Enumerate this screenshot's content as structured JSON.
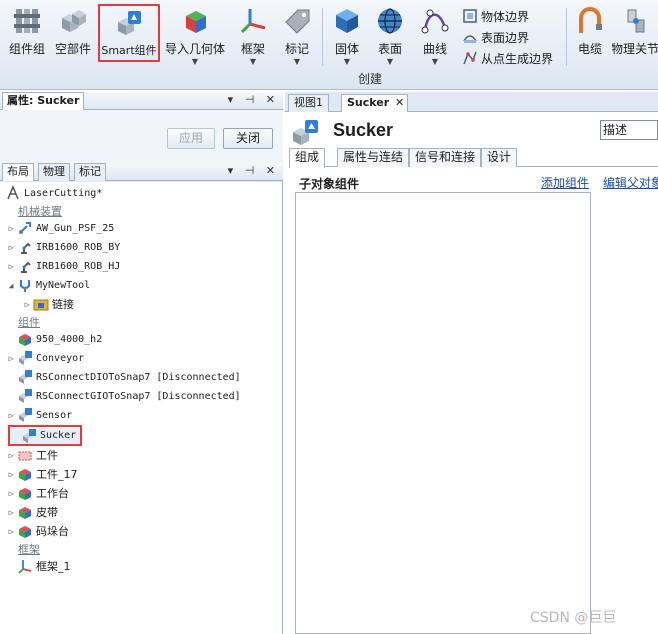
{
  "ribbon": {
    "buttons": [
      {
        "label": "组件组",
        "icon": "component-group-icon"
      },
      {
        "label": "空部件",
        "icon": "empty-part-icon"
      },
      {
        "label": "Smart组件",
        "icon": "smart-component-icon"
      },
      {
        "label": "导入几何体",
        "icon": "import-geometry-icon"
      },
      {
        "label": "框架",
        "icon": "frame-icon"
      },
      {
        "label": "标记",
        "icon": "tag-icon"
      },
      {
        "label": "固体",
        "icon": "solid-icon"
      },
      {
        "label": "表面",
        "icon": "surface-icon"
      },
      {
        "label": "曲线",
        "icon": "curve-icon"
      },
      {
        "label": "电缆",
        "icon": "cable-icon"
      },
      {
        "label": "物理关节",
        "icon": "physics-joint-icon"
      }
    ],
    "small_buttons": [
      {
        "label": "物体边界",
        "icon": "body-border-icon"
      },
      {
        "label": "表面边界",
        "icon": "surface-border-icon"
      },
      {
        "label": "从点生成边界",
        "icon": "border-from-points-icon"
      }
    ],
    "group_label": "创建"
  },
  "properties_pane": {
    "title": "属性: Sucker",
    "apply_label": "应用",
    "close_label": "关闭"
  },
  "layout_pane": {
    "tabs": [
      "布局",
      "物理",
      "标记"
    ],
    "station": "LaserCutting*",
    "sections": {
      "mechanisms": "机械装置",
      "components": "组件",
      "frames": "框架"
    },
    "mechanisms": [
      "AW_Gun_PSF_25",
      "IRB1600_ROB_BY",
      "IRB1600_ROB_HJ",
      "MyNewTool"
    ],
    "mechanism_child": "链接",
    "components": [
      "950_4000_h2",
      "Conveyor",
      "RSConnectDIOToSnap7 [Disconnected]",
      "RSConnectGIOToSnap7 [Disconnected]",
      "Sensor",
      "Sucker",
      "工件",
      "工件_17",
      "工作台",
      "皮带",
      "码垛台"
    ],
    "frames": [
      "框架_1"
    ]
  },
  "document": {
    "tabs": [
      "视图1",
      "Sucker"
    ],
    "title": "Sucker",
    "description_field": "描述",
    "sub_tabs": [
      "组成",
      "属性与连结",
      "信号和连接",
      "设计"
    ],
    "sub_objects_label": "子对象组件",
    "add_component_link": "添加组件",
    "edit_parent_link": "编辑父对象"
  },
  "watermark": "CSDN @巨巨"
}
